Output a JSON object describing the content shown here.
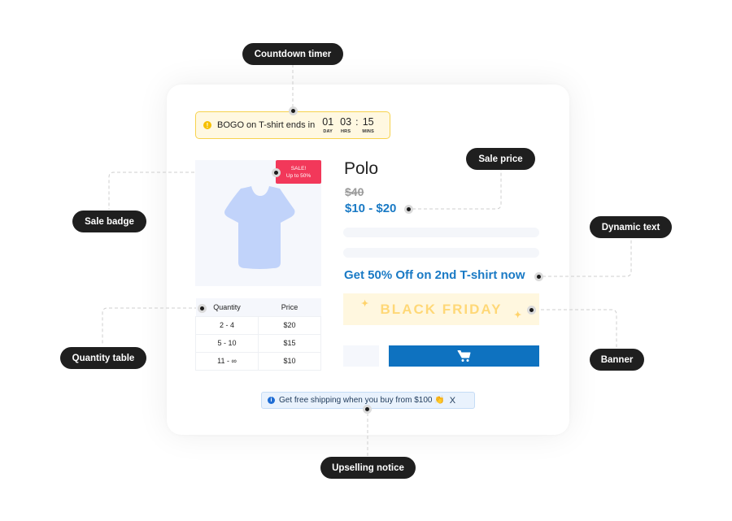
{
  "callouts": {
    "countdown_timer": "Countdown timer",
    "sale_badge": "Sale badge",
    "sale_price": "Sale price",
    "dynamic_text": "Dynamic text",
    "quantity_table": "Quantity table",
    "banner": "Banner",
    "upselling_notice": "Upselling notice"
  },
  "countdown": {
    "icon": "info-icon",
    "text": "BOGO on T-shirt ends in",
    "day": "01",
    "day_label": "DAY",
    "hrs": "03",
    "hrs_label": "HRS",
    "separator": ":",
    "mins": "15",
    "mins_label": "MINS"
  },
  "product": {
    "image_icon": "tshirt-icon",
    "badge_line1": "SALE!",
    "badge_line2": "Up to 50%",
    "title": "Polo",
    "old_price": "$40",
    "sale_price": "$10 - $20",
    "dynamic_text": "Get 50% Off on 2nd T-shirt now",
    "banner_text": "BLACK FRIDAY",
    "cart_icon": "cart-icon"
  },
  "quantity_table": {
    "headers": [
      "Quantity",
      "Price"
    ],
    "rows": [
      [
        "2 - 4",
        "$20"
      ],
      [
        "5 - 10",
        "$15"
      ],
      [
        "11 - ∞",
        "$10"
      ]
    ]
  },
  "upsell": {
    "icon": "info-icon",
    "text": "Get free shipping when you buy from $100 👏",
    "close": "X"
  },
  "colors": {
    "accent_blue": "#1a7ac5",
    "button_blue": "#0e72c0",
    "sale_red": "#f2385a",
    "timer_yellow": "#f7d24d",
    "banner_gold": "#ffd877",
    "tshirt": "#c1d3fa"
  }
}
